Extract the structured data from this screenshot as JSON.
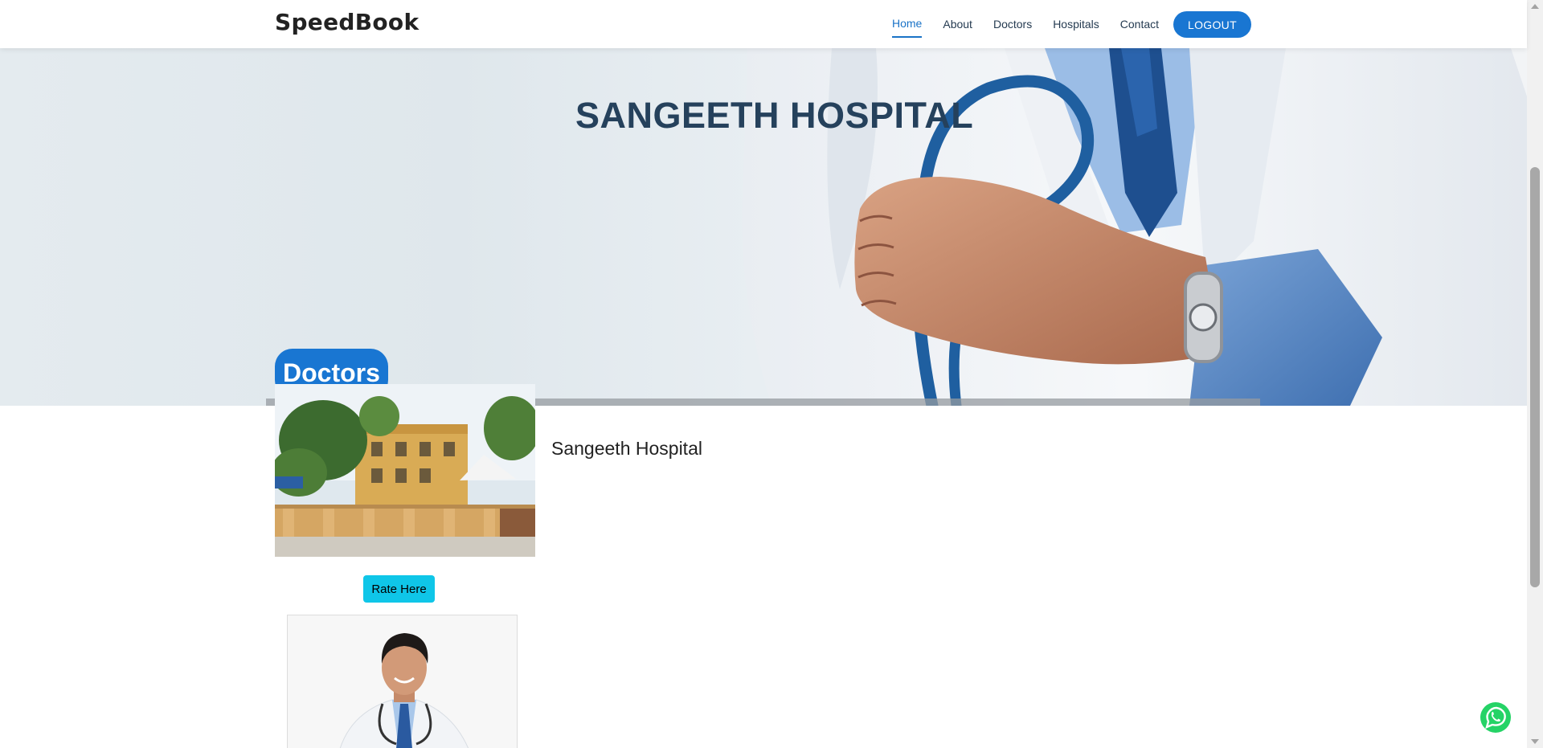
{
  "header": {
    "logo": "SpeedBook",
    "nav": [
      {
        "label": "Home",
        "active": true
      },
      {
        "label": "About",
        "active": false
      },
      {
        "label": "Doctors",
        "active": false
      },
      {
        "label": "Hospitals",
        "active": false
      },
      {
        "label": "Contact",
        "active": false
      }
    ],
    "logout_label": "LOGOUT"
  },
  "hero": {
    "title": "SANGEETH HOSPITAL",
    "section_label": "Doctors",
    "image": "doctor-with-stethoscope-photo"
  },
  "hospital": {
    "name": "Sangeeth Hospital",
    "photo": "hospital-building-photo",
    "rate_label": "Rate Here"
  },
  "doctor_card": {
    "photo": "doctor-portrait-photo"
  },
  "widgets": {
    "whatsapp_icon": "whatsapp-icon"
  },
  "colors": {
    "primary": "#1976d2",
    "title": "#25415c",
    "rate_button": "#0fc6e8",
    "whatsapp": "#25d366"
  }
}
